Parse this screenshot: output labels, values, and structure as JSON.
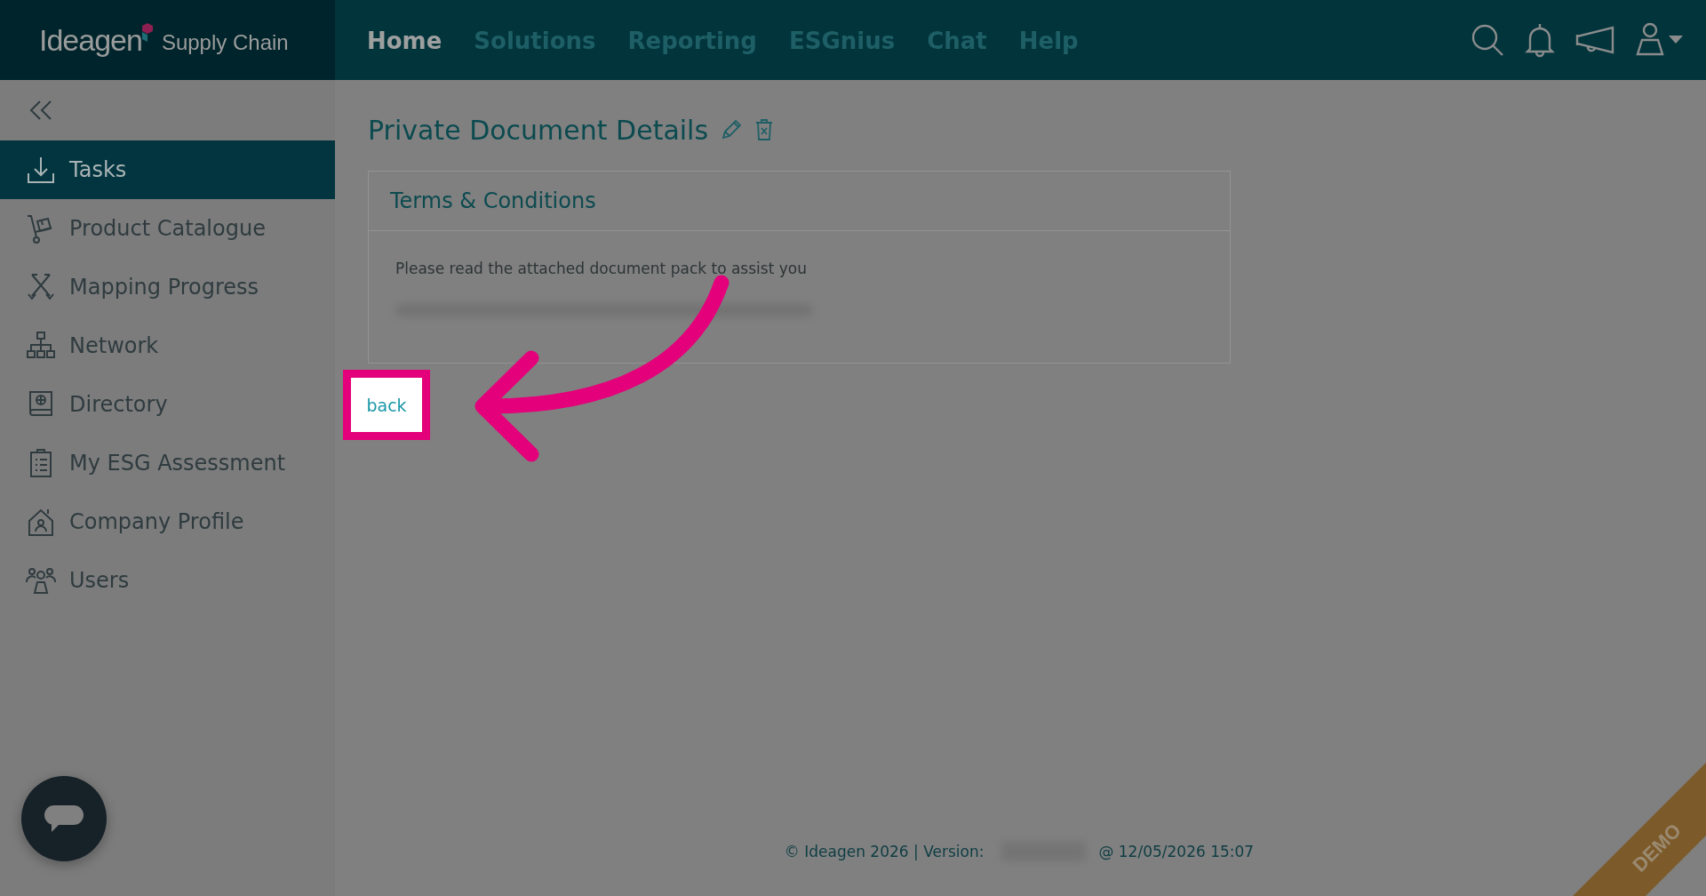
{
  "header": {
    "logo": {
      "brand": "Ideagen",
      "product": "Supply Chain"
    },
    "nav": [
      {
        "label": "Home",
        "selected": true
      },
      {
        "label": "Solutions",
        "selected": false
      },
      {
        "label": "Reporting",
        "selected": false
      },
      {
        "label": "ESGnius",
        "selected": false
      },
      {
        "label": "Chat",
        "selected": false
      },
      {
        "label": "Help",
        "selected": false
      }
    ]
  },
  "sidebar": {
    "items": [
      {
        "label": "Tasks",
        "selected": true
      },
      {
        "label": "Product Catalogue",
        "selected": false
      },
      {
        "label": "Mapping Progress",
        "selected": false
      },
      {
        "label": "Network",
        "selected": false
      },
      {
        "label": "Directory",
        "selected": false
      },
      {
        "label": "My ESG Assessment",
        "selected": false
      },
      {
        "label": "Company Profile",
        "selected": false
      },
      {
        "label": "Users",
        "selected": false
      }
    ]
  },
  "page": {
    "title": "Private Document Details",
    "card": {
      "title": "Terms & Conditions",
      "text": "Please read the attached document pack to assist you"
    },
    "back_button": "back"
  },
  "footer": {
    "copyright": "© Ideagen 2026 | Version:",
    "timestamp": "@ 12/05/2026 15:07"
  },
  "ribbon": "DEMO"
}
